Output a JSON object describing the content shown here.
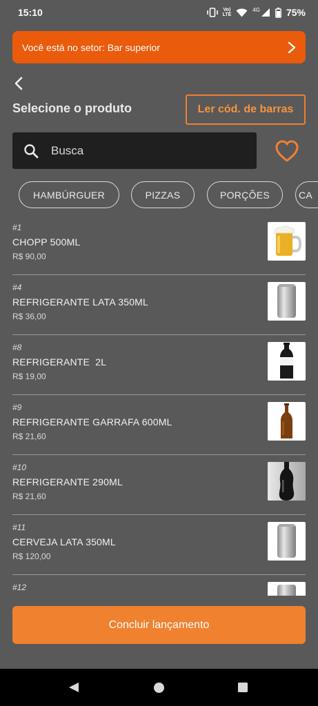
{
  "status": {
    "time": "15:10",
    "signal_top": "Vo)",
    "signal_bottom": "LTE",
    "network": "4G",
    "battery": "75%"
  },
  "banner": {
    "text": "Você está no setor: Bar superior"
  },
  "header": {
    "title": "Selecione o produto",
    "barcode_label": "Ler cód. de barras"
  },
  "search": {
    "placeholder": "Busca"
  },
  "categories": [
    "HAMBÚRGUER",
    "PIZZAS",
    "PORÇÕES",
    "CA"
  ],
  "products": [
    {
      "num": "#1",
      "name": "CHOPP 500ML",
      "price": "R$ 90,00",
      "image": "beer-mug"
    },
    {
      "num": "#4",
      "name": "REFRIGERANTE LATA 350ML",
      "price": "R$ 36,00",
      "image": "can"
    },
    {
      "num": "#8",
      "name": "REFRIGERANTE  2L",
      "price": "R$ 19,00",
      "image": "soda-bottle-2l"
    },
    {
      "num": "#9",
      "name": "REFRIGERANTE GARRAFA 600ML",
      "price": "R$ 21,60",
      "image": "amber-bottle"
    },
    {
      "num": "#10",
      "name": "REFRIGERANTE 290ML",
      "price": "R$ 21,60",
      "image": "glass-bottle"
    },
    {
      "num": "#11",
      "name": "CERVEJA LATA 350ML",
      "price": "R$ 120,00",
      "image": "can"
    },
    {
      "num": "#12",
      "name": "",
      "price": "",
      "image": "can"
    }
  ],
  "footer": {
    "conclude_label": "Concluir lançamento"
  },
  "colors": {
    "accent": "#f0812f",
    "banner": "#ea5b0c",
    "background": "#595959"
  }
}
